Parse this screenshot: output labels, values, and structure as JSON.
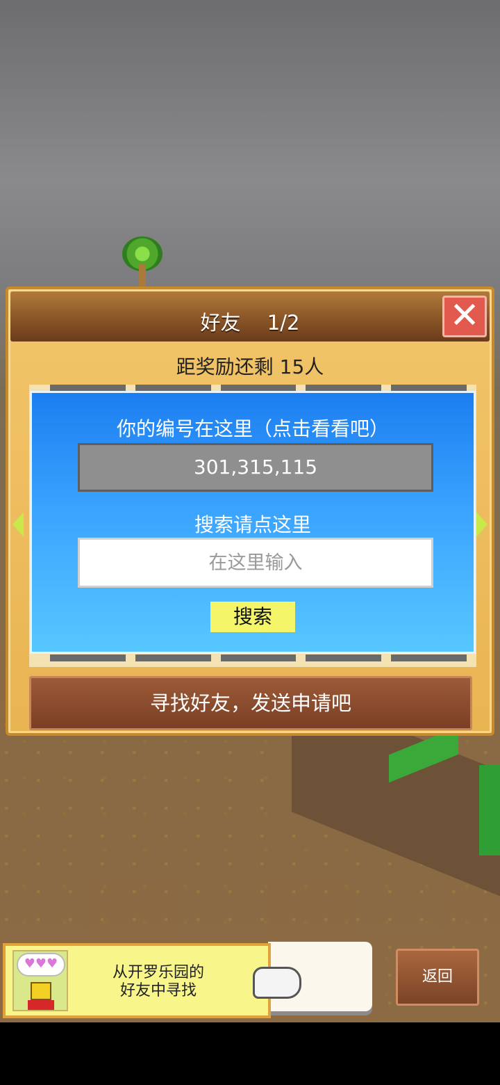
{
  "dialog": {
    "title": "好友　 1/2",
    "close_icon": "✕",
    "reward_text": "距奖励还剩 15人",
    "id_label": "你的编号在这里（点击看看吧）",
    "player_id": "301,315,115",
    "search_label": "搜索请点这里",
    "search_placeholder": "在这里输入",
    "search_button": "搜索",
    "find_friends_button": "寻找好友，发送申请吧"
  },
  "bottom": {
    "invite_text_line1": "从开罗乐园的",
    "invite_text_line2": "好友中寻找",
    "avatar_hearts": "♥♥♥",
    "back_button": "返回"
  },
  "icons": {
    "close": "close-icon",
    "left_arrow": "chevron-left-icon",
    "right_arrow": "chevron-right-icon",
    "pointing_hand": "pointing-hand-icon"
  },
  "colors": {
    "panel_blue": "#1c7ef0",
    "header_brown": "#8a5527",
    "close_red": "#e25a4e",
    "search_button_yellow": "#f5f56a"
  }
}
